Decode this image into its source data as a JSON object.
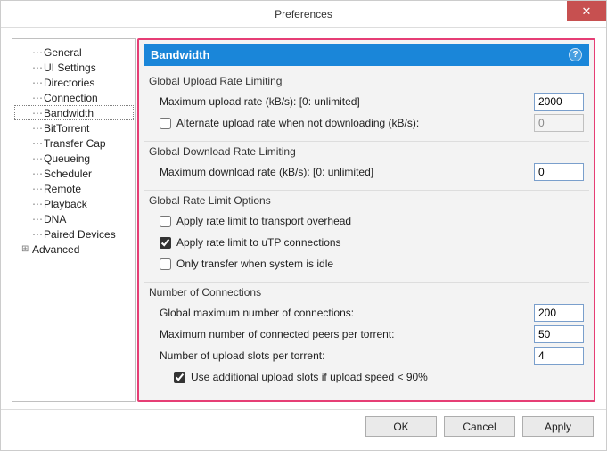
{
  "window": {
    "title": "Preferences"
  },
  "tree": {
    "items": [
      "General",
      "UI Settings",
      "Directories",
      "Connection",
      "Bandwidth",
      "BitTorrent",
      "Transfer Cap",
      "Queueing",
      "Scheduler",
      "Remote",
      "Playback",
      "DNA",
      "Paired Devices",
      "Advanced"
    ],
    "selected": "Bandwidth",
    "expandable": [
      "Advanced"
    ]
  },
  "pane": {
    "title": "Bandwidth",
    "upload": {
      "heading": "Global Upload Rate Limiting",
      "max_label": "Maximum upload rate (kB/s): [0: unlimited]",
      "max_value": "2000",
      "alt_label": "Alternate upload rate when not downloading (kB/s):",
      "alt_checked": false,
      "alt_value": "0"
    },
    "download": {
      "heading": "Global Download Rate Limiting",
      "max_label": "Maximum download rate (kB/s): [0: unlimited]",
      "max_value": "0"
    },
    "options": {
      "heading": "Global Rate Limit Options",
      "overhead_label": "Apply rate limit to transport overhead",
      "overhead_checked": false,
      "utp_label": "Apply rate limit to uTP connections",
      "utp_checked": true,
      "idle_label": "Only transfer when system is idle",
      "idle_checked": false
    },
    "connections": {
      "heading": "Number of Connections",
      "global_label": "Global maximum number of connections:",
      "global_value": "200",
      "peers_label": "Maximum number of connected peers per torrent:",
      "peers_value": "50",
      "slots_label": "Number of upload slots per torrent:",
      "slots_value": "4",
      "extra_label": "Use additional upload slots if upload speed < 90%",
      "extra_checked": true
    }
  },
  "buttons": {
    "ok": "OK",
    "cancel": "Cancel",
    "apply": "Apply"
  }
}
